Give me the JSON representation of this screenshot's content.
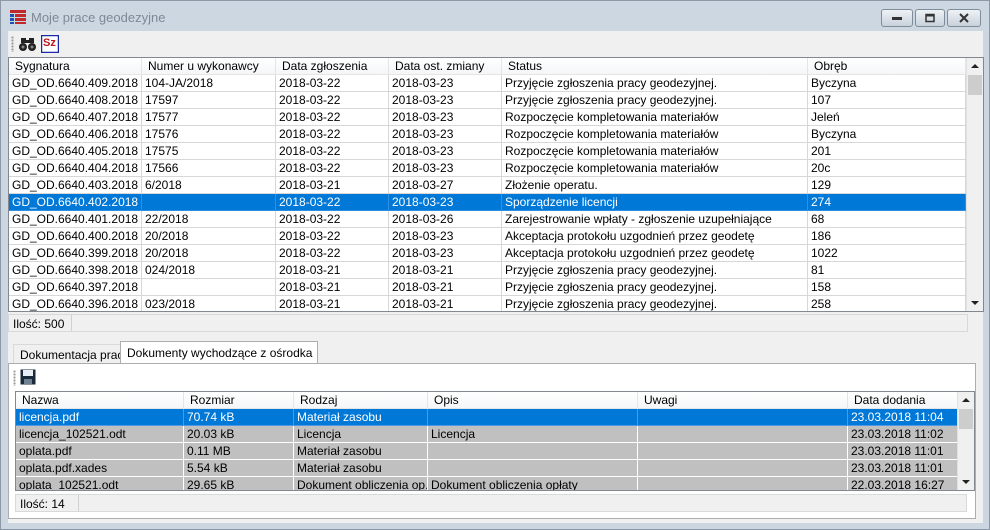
{
  "window": {
    "title": "Moje prace geodezyjne"
  },
  "toolbar": {
    "search_tooltip": "Szukaj",
    "sz_label": "Sz"
  },
  "works": {
    "columns": [
      "Sygnatura",
      "Numer u wykonawcy",
      "Data zgłoszenia",
      "Data ost. zmiany",
      "Status",
      "Obręb"
    ],
    "rows": [
      [
        "GD_OD.6640.409.2018",
        "104-JA/2018",
        "2018-03-22",
        "2018-03-23",
        "Przyjęcie zgłoszenia pracy geodezyjnej.",
        "Byczyna"
      ],
      [
        "GD_OD.6640.408.2018",
        "17597",
        "2018-03-22",
        "2018-03-23",
        "Przyjęcie zgłoszenia pracy geodezyjnej.",
        "107"
      ],
      [
        "GD_OD.6640.407.2018",
        "17577",
        "2018-03-22",
        "2018-03-23",
        "Rozpoczęcie kompletowania materiałów",
        "Jeleń"
      ],
      [
        "GD_OD.6640.406.2018",
        "17576",
        "2018-03-22",
        "2018-03-23",
        "Rozpoczęcie kompletowania materiałów",
        "Byczyna"
      ],
      [
        "GD_OD.6640.405.2018",
        "17575",
        "2018-03-22",
        "2018-03-23",
        "Rozpoczęcie kompletowania materiałów",
        "201"
      ],
      [
        "GD_OD.6640.404.2018",
        "17566",
        "2018-03-22",
        "2018-03-23",
        "Rozpoczęcie kompletowania materiałów",
        "20c"
      ],
      [
        "GD_OD.6640.403.2018",
        "6/2018",
        "2018-03-21",
        "2018-03-27",
        "Złożenie operatu.",
        "129"
      ],
      [
        "GD_OD.6640.402.2018",
        "",
        "2018-03-22",
        "2018-03-23",
        "Sporządzenie licencji",
        "274"
      ],
      [
        "GD_OD.6640.401.2018",
        "22/2018",
        "2018-03-22",
        "2018-03-26",
        "Zarejestrowanie wpłaty - zgłoszenie uzupełniające",
        "68"
      ],
      [
        "GD_OD.6640.400.2018",
        "20/2018",
        "2018-03-22",
        "2018-03-23",
        "Akceptacja protokołu uzgodnień przez geodetę",
        "186"
      ],
      [
        "GD_OD.6640.399.2018",
        "20/2018",
        "2018-03-22",
        "2018-03-23",
        "Akceptacja protokołu uzgodnień przez geodetę",
        "1022"
      ],
      [
        "GD_OD.6640.398.2018",
        "024/2018",
        "2018-03-21",
        "2018-03-21",
        "Przyjęcie zgłoszenia pracy geodezyjnej.",
        "81"
      ],
      [
        "GD_OD.6640.397.2018",
        "",
        "2018-03-21",
        "2018-03-21",
        "Przyjęcie zgłoszenia pracy geodezyjnej.",
        "158"
      ],
      [
        "GD_OD.6640.396.2018",
        "023/2018",
        "2018-03-21",
        "2018-03-21",
        "Przyjęcie zgłoszenia pracy geodezyjnej.",
        "258"
      ]
    ],
    "selected_row": 7,
    "count_label": "Ilość: 500"
  },
  "tabs": [
    {
      "label": "Dokumentacja pracy",
      "active": false
    },
    {
      "label": "Dokumenty wychodzące z ośrodka",
      "active": true
    }
  ],
  "documents": {
    "columns": [
      "Nazwa",
      "Rozmiar",
      "Rodzaj",
      "Opis",
      "Uwagi",
      "Data dodania"
    ],
    "rows": [
      [
        "licencja.pdf",
        "70.74 kB",
        "Materiał zasobu",
        "",
        "",
        "23.03.2018 11:04"
      ],
      [
        "licencja_102521.odt",
        "20.03 kB",
        "Licencja",
        "Licencja",
        "",
        "23.03.2018 11:02"
      ],
      [
        "oplata.pdf",
        "0.11 MB",
        "Materiał zasobu",
        "",
        "",
        "23.03.2018 11:01"
      ],
      [
        "oplata.pdf.xades",
        "5.54 kB",
        "Materiał zasobu",
        "",
        "",
        "23.03.2018 11:01"
      ],
      [
        "oplata_102521.odt",
        "29.65 kB",
        "Dokument obliczenia op...",
        "Dokument obliczenia opłaty",
        "",
        "22.03.2018 16:27"
      ]
    ],
    "selected_row": 0,
    "count_label": "Ilość: 14"
  },
  "icons": {
    "app": "table-grid-icon",
    "binoculars": "binoculars-icon",
    "sz": "sz-icon",
    "save": "floppy-disk-icon"
  },
  "colors": {
    "selection": "#0078d7",
    "title_text": "#7d8995"
  }
}
